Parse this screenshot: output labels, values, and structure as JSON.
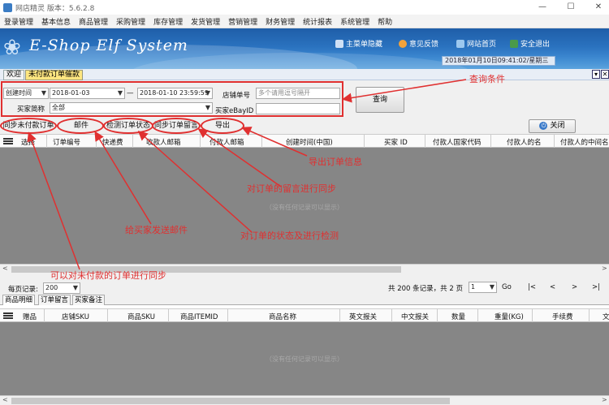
{
  "window": {
    "title": "网店精灵  版本：5.6.2.8",
    "controls": [
      "—",
      "☐",
      "✕"
    ]
  },
  "menu": [
    "登录管理",
    "基本信息",
    "商品管理",
    "采购管理",
    "库存管理",
    "发货管理",
    "营销管理",
    "财务管理",
    "统计报表",
    "系统管理",
    "帮助"
  ],
  "banner": {
    "logo": "E-Shop Elf System",
    "links": [
      {
        "label": "主菜单隐藏",
        "icon": "menu-icon"
      },
      {
        "label": "意见反馈",
        "icon": "feedback-icon"
      },
      {
        "label": "网站首页",
        "icon": "home-icon"
      },
      {
        "label": "安全退出",
        "icon": "exit-icon"
      }
    ],
    "datetime": "2018年01月10日09:41:02/星期三"
  },
  "tabs": [
    "欢迎",
    "未付款订单催款"
  ],
  "query": {
    "time_type": "创建时间",
    "start_date": "2018-01-03",
    "end_date": "2018-01-10 23:59:59",
    "dash": "—",
    "buyer_label": "买家简称",
    "buyer_value": "全部",
    "store_label": "店铺单号",
    "store_placeholder": "多个请用逗号隔开",
    "ebay_label": "买家eBayID",
    "ebay_value": "",
    "submit": "查询"
  },
  "toolbar": {
    "sync_unpaid": "同步未付款订单",
    "mail": "邮件",
    "check_status": "检测订单状态",
    "sync_message": "同步订单留言",
    "export": "导出",
    "close": "关闭"
  },
  "orders_grid": {
    "columns": [
      "选择",
      "订单编号",
      "快递费",
      "收款人邮箱",
      "付款人邮箱",
      "创建时间(中国)",
      "买家 ID",
      "付款人国家代码",
      "付款人的名",
      "付款人的中间名"
    ],
    "empty": "（没有任何记录可以显示）"
  },
  "pager": {
    "per_page_label": "每页记录:",
    "per_page": "200",
    "total": "共 200 条记录，共 2 页",
    "page": "1",
    "go": "Go",
    "nav": [
      "|<",
      "<",
      ">",
      ">|"
    ]
  },
  "sub_tabs": [
    "商品明细",
    "订单留言",
    "买家备注"
  ],
  "items_grid": {
    "columns": [
      "赠品",
      "店铺SKU",
      "商品SKU",
      "商品ITEMID",
      "商品名称",
      "英文报关",
      "中文报关",
      "数量",
      "重量(KG)",
      "手续费",
      "文"
    ],
    "empty": "（没有任何记录可以显示）"
  },
  "annotations": {
    "query": "查询条件",
    "export": "导出订单信息",
    "sync_message": "对订单的留言进行同步",
    "mail": "给买家发送邮件",
    "check_status": "对订单的状态及进行检测",
    "sync_unpaid": "可以对未付款的订单进行同步"
  },
  "colors": {
    "annotation": "#e03030",
    "banner": "#2a72bf",
    "active_tab": "#ffe680",
    "grid_body": "#868686"
  }
}
